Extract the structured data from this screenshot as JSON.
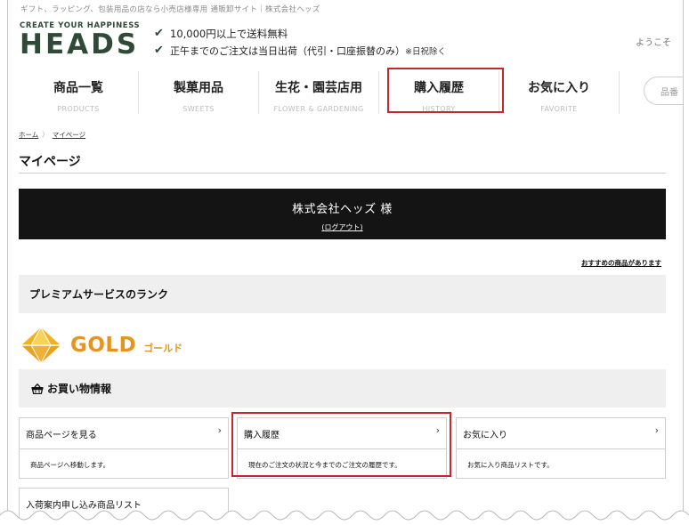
{
  "topline": "ギフト、ラッピング、包装用品の店なら小売店様専用 通販卸サイト｜株式会社ヘッズ",
  "logo": {
    "tagline": "CREATE YOUR HAPPINESS",
    "mark": "HEADS"
  },
  "promo": {
    "line1": "10,000円以上で送料無料",
    "line2": "正午までのご注文は当日出荷（代引・口座振替のみ）",
    "line2_note": "※日祝除く"
  },
  "welcome": "ようこそ",
  "nav": [
    {
      "jp": "商品一覧",
      "en": "PRODUCTS"
    },
    {
      "jp": "製菓用品",
      "en": "SWEETS"
    },
    {
      "jp": "生花・園芸店用",
      "en": "FLOWER & GARDENING"
    },
    {
      "jp": "購入履歴",
      "en": "HISTORY"
    },
    {
      "jp": "お気に入り",
      "en": "FAVORITE"
    }
  ],
  "search": {
    "placeholder": "品番"
  },
  "breadcrumb": {
    "home": "ホーム",
    "current": "マイページ"
  },
  "page_title": "マイページ",
  "member": {
    "name": "株式会社ヘッズ 様",
    "logout": "(ログアウト)"
  },
  "recommend": "おすすめの商品があります",
  "rank": {
    "heading": "プレミアムサービスのランク",
    "level": "GOLD",
    "level_kana": "ゴールド"
  },
  "shopping": {
    "heading": "お買い物情報"
  },
  "cards": [
    {
      "title": "商品ページを見る",
      "desc": "商品ページへ移動します。"
    },
    {
      "title": "購入履歴",
      "desc": "現在のご注文の状況と今までのご注文の履歴です。"
    },
    {
      "title": "お気に入り",
      "desc": "お気に入り商品リストです。"
    }
  ],
  "card_partial": "入荷案内申し込み商品リスト",
  "colors": {
    "brand_green": "#2f4a36",
    "gold": "#e8931d",
    "highlight_red": "#c6262e",
    "bar_black": "#141414"
  }
}
